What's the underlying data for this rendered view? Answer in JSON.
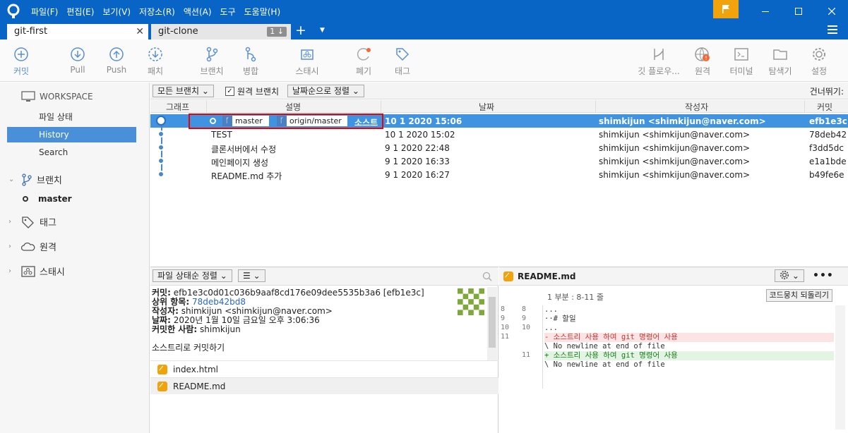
{
  "menu": [
    "파일(F)",
    "편집(E)",
    "보기(V)",
    "저장소(R)",
    "액션(A)",
    "도구",
    "도움말(H)"
  ],
  "tabs": {
    "active": "git-first",
    "inactive": "git-clone",
    "inactive_count": "1 ↓"
  },
  "toolbar": {
    "commit": "커밋",
    "pull": "Pull",
    "push": "Push",
    "fetch": "패치",
    "branch": "브랜치",
    "merge": "병합",
    "stash": "스태시",
    "discard": "폐기",
    "tag": "태그",
    "gitflow": "깃 플로우...",
    "remote": "원격",
    "terminal": "터미널",
    "explorer": "탐색기",
    "settings": "설정"
  },
  "sidebar": {
    "workspace": "WORKSPACE",
    "items": [
      "파일 상태",
      "History",
      "Search"
    ],
    "branches_label": "브랜치",
    "current_branch": "master",
    "tags_label": "태그",
    "remotes_label": "원격",
    "stash_label": "스태시"
  },
  "filter": {
    "branches": "모든 브랜치 ⌄",
    "remote_checkbox": "원격 브랜치",
    "sort": "날짜순으로 정렬 ⌄",
    "skip": "건너뛰기:"
  },
  "columns": {
    "graph": "그래프",
    "desc": "설명",
    "date": "날짜",
    "author": "작성자",
    "commit": "커밋"
  },
  "commits": [
    {
      "desc": "소스트",
      "date": "10 1 2020 15:06",
      "author": "shimkijun <shimkijun@naver.com>",
      "hash": "efb1e3c"
    },
    {
      "desc": "TEST",
      "date": "10 1 2020 15:02",
      "author": "shimkijun <shimkijun@naver.com>",
      "hash": "78deb42"
    },
    {
      "desc": "클론서버에서 수정",
      "date": "9 1 2020 22:48",
      "author": "shimkijun <shimkijun@naver.com>",
      "hash": "f3dd5dc"
    },
    {
      "desc": "메인페이지 생성",
      "date": "9 1 2020 16:33",
      "author": "shimkijun <shimkijun@naver.com>",
      "hash": "e1a1bde"
    },
    {
      "desc": "README.md 추가",
      "date": "9 1 2020 16:27",
      "author": "shimkijun <shimkijun@naver.com>",
      "hash": "b49fe6e"
    }
  ],
  "refs": {
    "local": "master",
    "remote": "origin/master"
  },
  "lower_left": {
    "sort": "파일 상태순 정렬 ⌄",
    "view": "☰ ⌄",
    "commit_label": "커밋:",
    "commit_value": "efb1e3c0d01c036b9aaf8cd176e09dee5535b3a6 [efb1e3c]",
    "parent_label": "상위 항목:",
    "parent_value": "78deb42bd8",
    "author_label": "작성자:",
    "author_value": "shimkijun <shimkijun@naver.com>",
    "date_label": "날짜:",
    "date_value": "2020년 1월 10일 금요일 오후 3:06:36",
    "committer_label": "커밋한 사람:",
    "committer_value": "shimkijun",
    "message": "소스트리로 커밋하기",
    "files": [
      "index.html",
      "README.md"
    ]
  },
  "lower_right": {
    "file": "README.md",
    "hunk": "1 부분 : 8-11 줄",
    "revert": "코드뭉치 되돌리기",
    "lines": [
      {
        "old": "8",
        "new": "8",
        "text": "...",
        "type": "ctx"
      },
      {
        "old": "9",
        "new": "9",
        "text": "··# 할일",
        "type": "ctx"
      },
      {
        "old": "10",
        "new": "10",
        "text": "...",
        "type": "ctx"
      },
      {
        "old": "11",
        "new": "",
        "text": "- 소스트리 사용 하여 git 명령어 사용",
        "type": "del"
      },
      {
        "old": "",
        "new": "",
        "text": "\\ No newline at end of file",
        "type": "ctx"
      },
      {
        "old": "",
        "new": "11",
        "text": "+ 소스트리 사용 하여 git 명령어 사용",
        "type": "add"
      },
      {
        "old": "",
        "new": "",
        "text": "\\ No newline at end of file",
        "type": "ctx"
      }
    ]
  },
  "colors": {
    "accent": "#0865c5",
    "selection": "#3f93e0",
    "sidebar_sel": "#4a90d9",
    "flag": "#f0a30a"
  }
}
